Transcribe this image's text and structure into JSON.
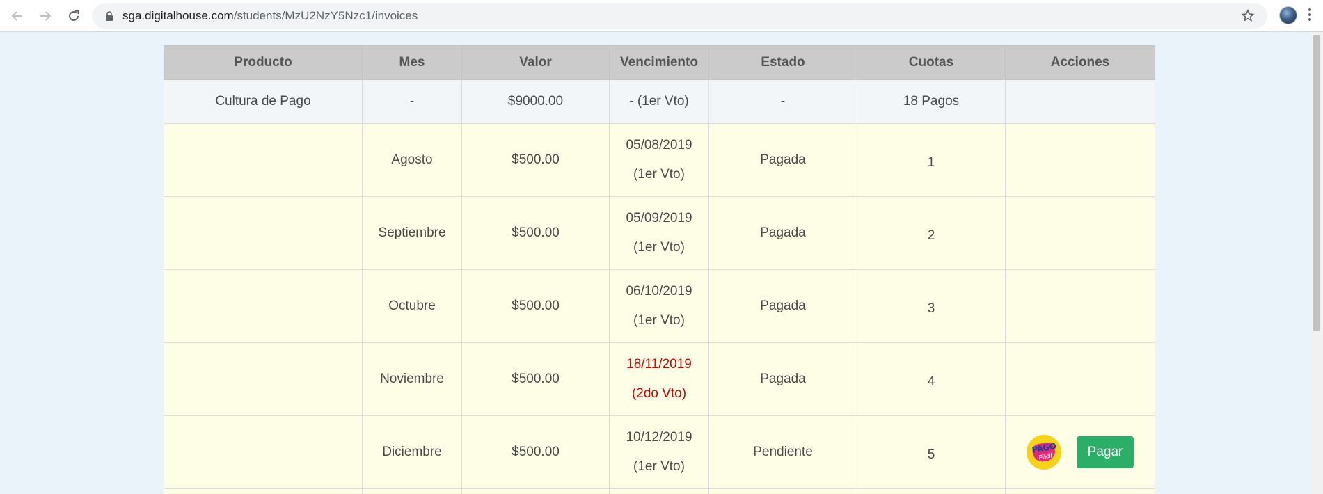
{
  "browser": {
    "url_domain": "sga.digitalhouse.com",
    "url_path": "/students/MzU2NzY5Nzc1/invoices"
  },
  "table": {
    "headers": [
      "Producto",
      "Mes",
      "Valor",
      "Vencimiento",
      "Estado",
      "Cuotas",
      "Acciones"
    ],
    "summary": {
      "producto": "Cultura de Pago",
      "mes": "-",
      "valor": "$9000.00",
      "vencimiento": "- (1er Vto)",
      "estado": "-",
      "cuotas": "18 Pagos"
    },
    "rows": [
      {
        "mes": "Agosto",
        "valor": "$500.00",
        "fecha": "05/08/2019",
        "vto": "(1er Vto)",
        "estado": "Pagada",
        "cuota": "1"
      },
      {
        "mes": "Septiembre",
        "valor": "$500.00",
        "fecha": "05/09/2019",
        "vto": "(1er Vto)",
        "estado": "Pagada",
        "cuota": "2"
      },
      {
        "mes": "Octubre",
        "valor": "$500.00",
        "fecha": "06/10/2019",
        "vto": "(1er Vto)",
        "estado": "Pagada",
        "cuota": "3"
      },
      {
        "mes": "Noviembre",
        "valor": "$500.00",
        "fecha": "18/11/2019",
        "vto": "(2do Vto)",
        "estado": "Pagada",
        "cuota": "4"
      },
      {
        "mes": "Diciembre",
        "valor": "$500.00",
        "fecha": "10/12/2019",
        "vto": "(1er Vto)",
        "estado": "Pendiente",
        "cuota": "5"
      }
    ],
    "pay_button_label": "Pagar",
    "pagofacil_logo_text": "PAGO Fácil"
  },
  "colors": {
    "late_due": "#d20000",
    "pay_button": "#2aae68",
    "installment_row_bg": "#fefee6"
  }
}
